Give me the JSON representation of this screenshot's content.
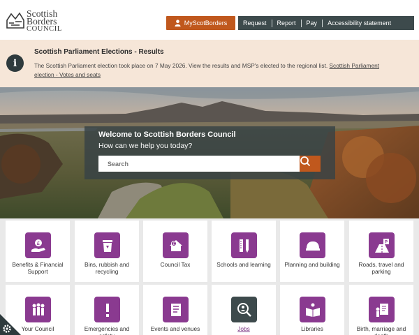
{
  "logo": {
    "line1": "Scottish",
    "line2": "Borders",
    "line3": "COUNCIL"
  },
  "header": {
    "myscot_label": "MyScotBorders",
    "nav": [
      "Request",
      "Report",
      "Pay",
      "Accessibility statement"
    ]
  },
  "alert": {
    "title": "Scottish Parliament Elections - Results",
    "body": "The Scottish Parliament election took place on 7 May 2026. View the results and MSP's elected to the regional list.",
    "link": "Scottish Parliament election - Votes and seats"
  },
  "search": {
    "title": "Welcome to Scottish Borders Council",
    "subtitle": "How can we help you today?",
    "placeholder": "Search"
  },
  "tiles": [
    {
      "label": "Benefits & Financial Support",
      "icon": "pound-hand-icon"
    },
    {
      "label": "Bins, rubbish and recycling",
      "icon": "recycle-bin-icon"
    },
    {
      "label": "Council Tax",
      "icon": "house-pound-icon"
    },
    {
      "label": "Schools and learning",
      "icon": "ruler-pencil-icon"
    },
    {
      "label": "Planning and building",
      "icon": "hard-hat-icon"
    },
    {
      "label": "Roads, travel and parking",
      "icon": "road-parking-icon"
    },
    {
      "label": "Your Council",
      "icon": "people-icon"
    },
    {
      "label": "Emergencies and safety",
      "icon": "exclamation-icon"
    },
    {
      "label": "Events and venues",
      "icon": "ticket-icon"
    },
    {
      "label": "Jobs",
      "icon": "magnifier-person-icon"
    },
    {
      "label": "Libraries",
      "icon": "reading-icon"
    },
    {
      "label": "Birth, marriage and death",
      "icon": "certificate-icon"
    }
  ],
  "colors": {
    "accent": "#c0581d",
    "purple": "#8a3a90",
    "dark": "#3d4a4c",
    "alert_bg": "#f6e6d8"
  }
}
